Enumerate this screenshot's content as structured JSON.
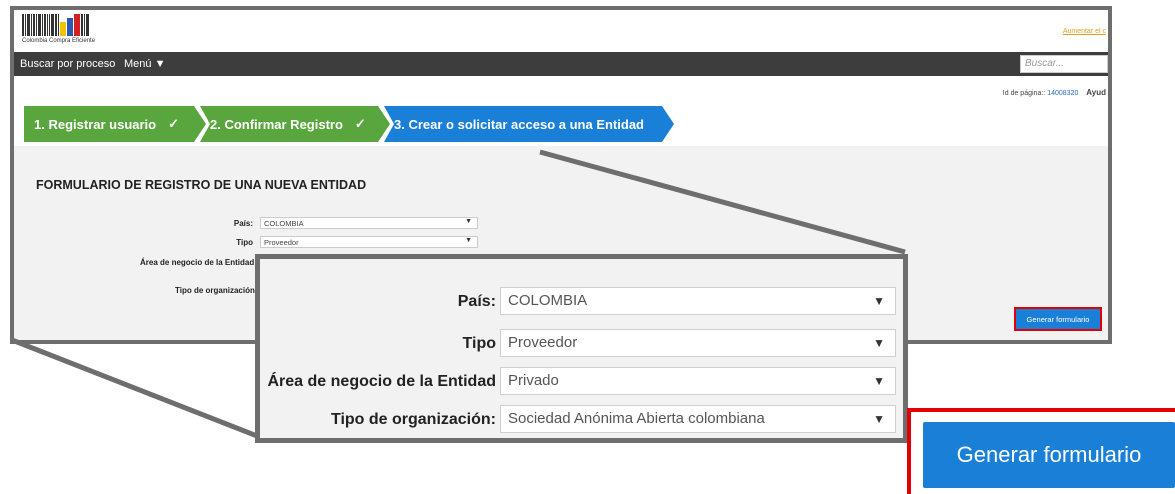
{
  "header": {
    "logo_text": "Colombia Compra Eficiente",
    "top_link": "Aumentar el c"
  },
  "navbar": {
    "items": [
      "Buscar por proceso",
      "Menú ▼"
    ],
    "search_placeholder": "Buscar..."
  },
  "page_info": {
    "id_label": "Id de página::",
    "id_value": "14008320",
    "help": "Ayud"
  },
  "steps": [
    {
      "label": "1. Registrar usuario",
      "check": "✓",
      "status": "done"
    },
    {
      "label": "2. Confirmar Registro",
      "check": "✓",
      "status": "done"
    },
    {
      "label": "3. Crear o solicitar acceso a una Entidad",
      "status": "active"
    }
  ],
  "form": {
    "title": "FORMULARIO DE REGISTRO DE UNA NUEVA ENTIDAD",
    "small_fields": [
      {
        "label": "País:",
        "value": "COLOMBIA"
      },
      {
        "label": "Tipo",
        "value": "Proveedor"
      },
      {
        "label": "Área de negocio de la Entidad",
        "value": ""
      },
      {
        "label": "Tipo de organización:",
        "value": ""
      }
    ],
    "generate_button": "Generar formulario"
  },
  "zoom": {
    "fields": [
      {
        "label": "País:",
        "value": "COLOMBIA"
      },
      {
        "label": "Tipo",
        "value": "Proveedor"
      },
      {
        "label": "Área de negocio de la Entidad",
        "value": "Privado"
      },
      {
        "label": "Tipo de organización:",
        "value": "Sociedad Anónima Abierta colombiana"
      }
    ],
    "generate_button": "Generar formulario"
  },
  "colors": {
    "step_done": "#5aa63e",
    "step_active": "#1a7fd6",
    "navbar": "#3d3d3d",
    "highlight": "#e30000",
    "frame": "#6e6e6e"
  },
  "icons": {
    "dropdown": "▼",
    "check": "✓"
  }
}
